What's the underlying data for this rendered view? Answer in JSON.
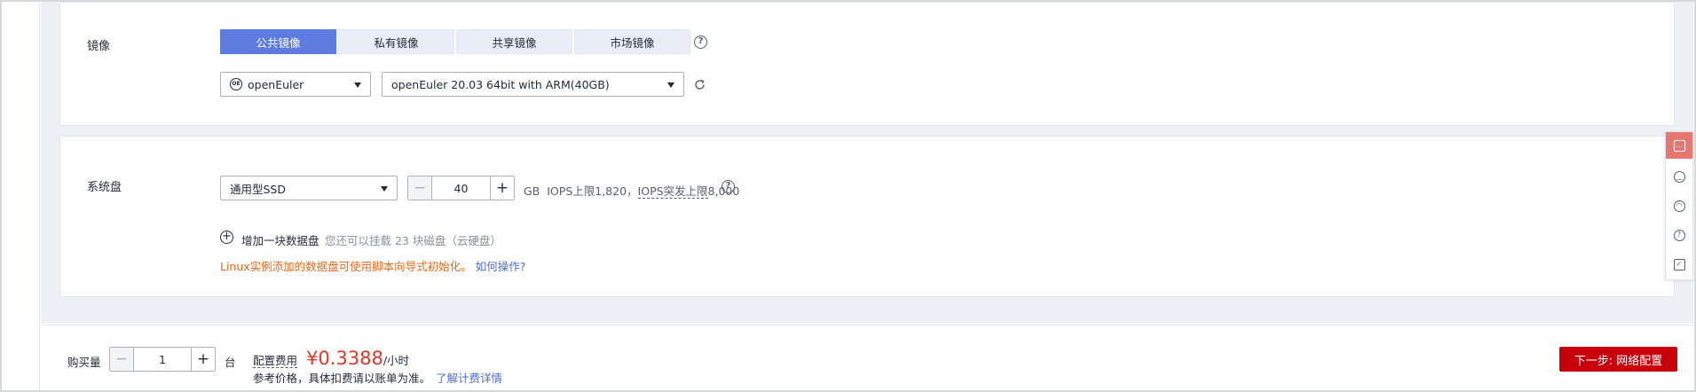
{
  "image_section": {
    "label": "镜像",
    "tabs": [
      {
        "label": "公共镜像",
        "active": true
      },
      {
        "label": "私有镜像",
        "active": false
      },
      {
        "label": "共享镜像",
        "active": false
      },
      {
        "label": "市场镜像",
        "active": false
      }
    ],
    "help_icon": "question-circle-icon",
    "os_select": {
      "value": "openEuler",
      "logo_text": "OE"
    },
    "version_select": {
      "value": "openEuler 20.03 64bit with ARM(40GB)"
    },
    "refresh_icon": "refresh-icon"
  },
  "disk_section": {
    "label": "系统盘",
    "type_select": {
      "value": "通用型SSD"
    },
    "size_value": "40",
    "unit": "GB",
    "iops_limit": "IOPS上限1,820，",
    "iops_burst_label": "IOPS突发上限",
    "iops_burst_value": "8,000",
    "add_disk_label": "增加一块数据盘",
    "add_disk_hint": "您还可以挂载 23 块磁盘（云硬盘）",
    "init_note": "Linux实例添加的数据盘可使用脚本向导式初始化。",
    "init_link": "如何操作?"
  },
  "footer": {
    "qty_label": "购买量",
    "qty_value": "1",
    "qty_unit": "台",
    "config_fee_label": "配置费用",
    "price": "¥0.3388",
    "price_unit": "/小时",
    "price_note": "参考价格，具体扣费请以账单为准。",
    "price_link": "了解计费详情",
    "next_button": "下一步: 网络配置"
  },
  "float_panel": {
    "items": [
      "feedback-icon",
      "smile-icon",
      "service-icon",
      "help-icon",
      "checklist-icon"
    ]
  },
  "colors": {
    "accent": "#5e7ce0",
    "primary_button": "#c7000b",
    "price": "#e0362c",
    "warning_text": "#e26a1b",
    "link": "#526ecc"
  }
}
